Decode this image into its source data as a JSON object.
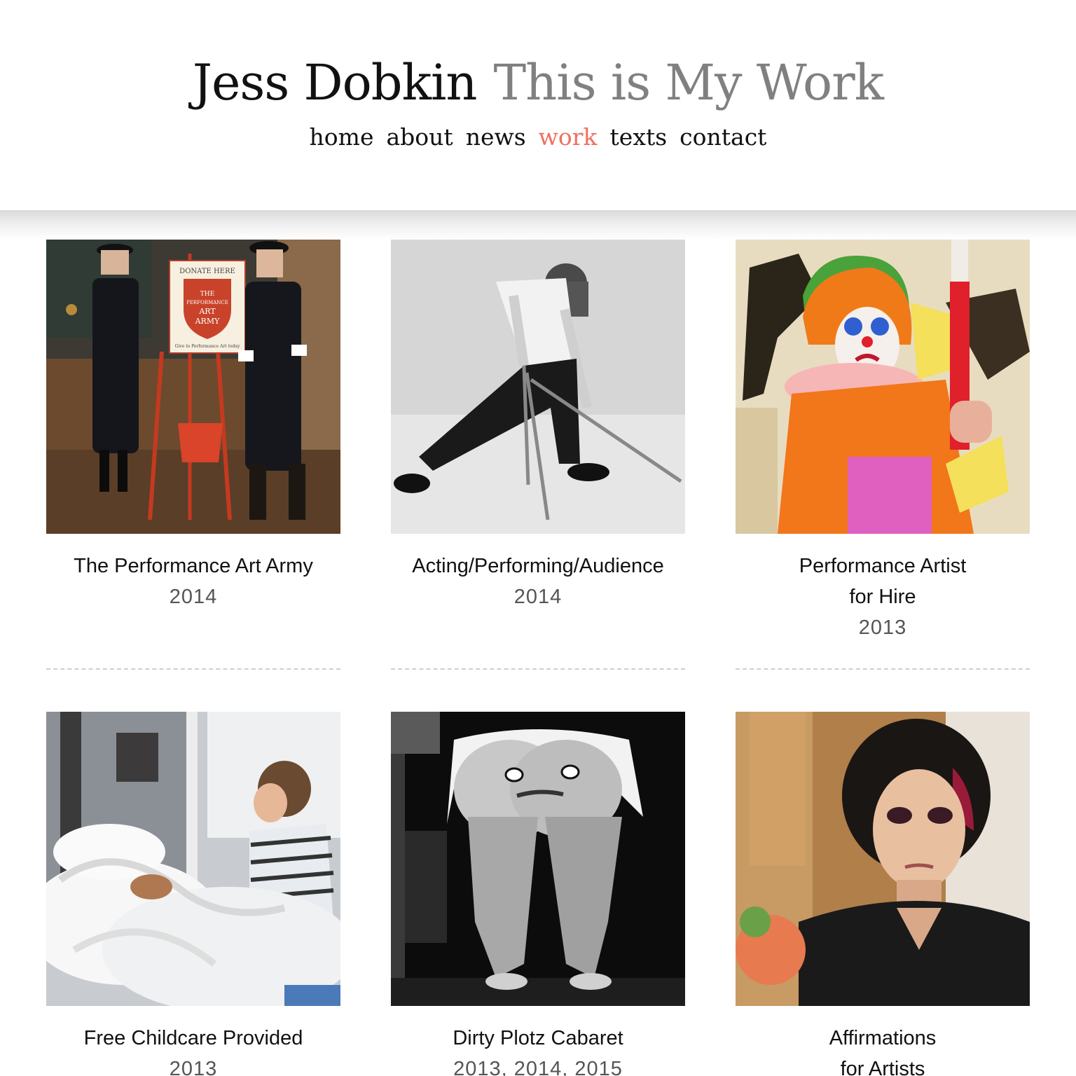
{
  "header": {
    "name": "Jess Dobkin",
    "tagline": "This is My Work"
  },
  "nav": {
    "items": [
      {
        "label": "home"
      },
      {
        "label": "about"
      },
      {
        "label": "news"
      },
      {
        "label": "work"
      },
      {
        "label": "texts"
      },
      {
        "label": "contact"
      }
    ],
    "active": "work",
    "active_color": "#ee7060"
  },
  "works": [
    {
      "title": "The Performance Art Army",
      "year": "2014"
    },
    {
      "title": "Acting/Performing/Audience",
      "year": "2014"
    },
    {
      "title": "Performance Artist",
      "title_line2": "for Hire",
      "year": "2013"
    },
    {
      "title": "Free Childcare Provided",
      "year": "2013"
    },
    {
      "title": "Dirty Plotz Cabaret",
      "year": "2013, 2014, 2015"
    },
    {
      "title": "Affirmations",
      "title_line2": "for Artists",
      "year": ""
    }
  ],
  "photo_1_sign": {
    "heading": "DONATE HERE",
    "emblem_line1": "THE",
    "emblem_line2": "PERFORMANCE",
    "emblem_line3": "ART",
    "emblem_line4": "ARMY",
    "footer": "Give to Performance Art today"
  }
}
